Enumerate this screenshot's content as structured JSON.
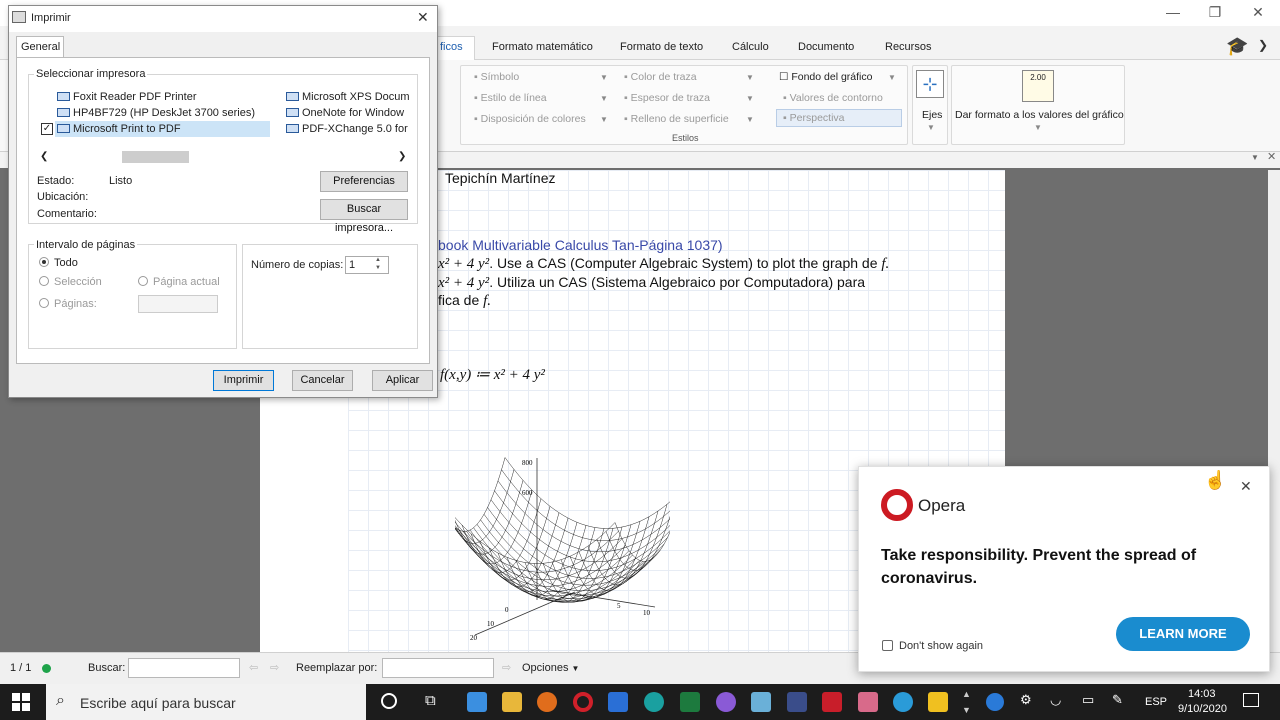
{
  "app": {
    "ribbon_tabs": [
      "ficos",
      "Formato matemático",
      "Formato de texto",
      "Cálculo",
      "Documento",
      "Recursos"
    ],
    "ribbon": {
      "col1": [
        "Símbolo",
        "Estilo de línea",
        "Disposición de colores"
      ],
      "col2": [
        "Color de traza",
        "Espesor de traza",
        "Relleno de superficie"
      ],
      "col3": [
        "Fondo del gráfico",
        "Valores de contorno",
        "Perspectiva"
      ],
      "estilos_label": "Estilos",
      "ejes_label": "Ejes",
      "dar_formato_label": "Dar formato a los valores del gráfico",
      "value_icon_text": "2.00"
    },
    "document": {
      "author": "Tepichín Martínez",
      "reference": "book Multivariable Calculus Tan-Página 1037)",
      "line1_expr": "x² + 4 y²",
      "line1_text": ". Use a CAS (Computer Algebraic System) to plot the graph de",
      "line1_end": "f.",
      "line2_expr": "x² + 4 y²",
      "line2_text": ". Utiliza un CAS (Sistema Algebraico por Computadora) para",
      "line3_text": "fica de",
      "line3_end": "f.",
      "definition": "f(x,y) ≔ x² + 4 y²",
      "plot_ticks": {
        "z_top": "800",
        "z_mid": "600",
        "y_0": "0",
        "y_10": "10",
        "y_20": "20",
        "x_5": "5",
        "x_10": "10"
      }
    },
    "statusbar": {
      "page": "1 / 1",
      "buscar_label": "Buscar:",
      "reemplazar_label": "Reemplazar por:",
      "opciones_label": "Opciones"
    }
  },
  "dialog": {
    "title": "Imprimir",
    "tab": "General",
    "select_printer_label": "Seleccionar impresora",
    "printers_left": [
      "Foxit Reader PDF Printer",
      "HP4BF729 (HP DeskJet 3700 series)",
      "Microsoft Print to PDF"
    ],
    "printers_right": [
      "Microsoft XPS Docum",
      "OneNote for Window",
      "PDF-XChange 5.0 for"
    ],
    "estado_label": "Estado:",
    "estado_value": "Listo",
    "ubicacion_label": "Ubicación:",
    "comentario_label": "Comentario:",
    "preferencias_button": "Preferencias",
    "buscar_impresora_button": "Buscar impresora...",
    "intervalo_label": "Intervalo de páginas",
    "todo_label": "Todo",
    "seleccion_label": "Selección",
    "pagina_actual_label": "Página actual",
    "paginas_label": "Páginas:",
    "copias_label": "Número de copias:",
    "copias_value": "1",
    "imprimir_button": "Imprimir",
    "cancelar_button": "Cancelar",
    "aplicar_button": "Aplicar"
  },
  "opera": {
    "brand": "Opera",
    "headline": "Take responsibility. Prevent the spread of coronavirus.",
    "dont_show": "Don't show again",
    "cta": "LEARN MORE",
    "brand_color": "#cc1a22",
    "cta_color": "#1a8ccf"
  },
  "taskbar": {
    "search_placeholder": "Escribe aquí para buscar",
    "lang": "ESP",
    "time": "14:03",
    "date": "9/10/2020"
  }
}
